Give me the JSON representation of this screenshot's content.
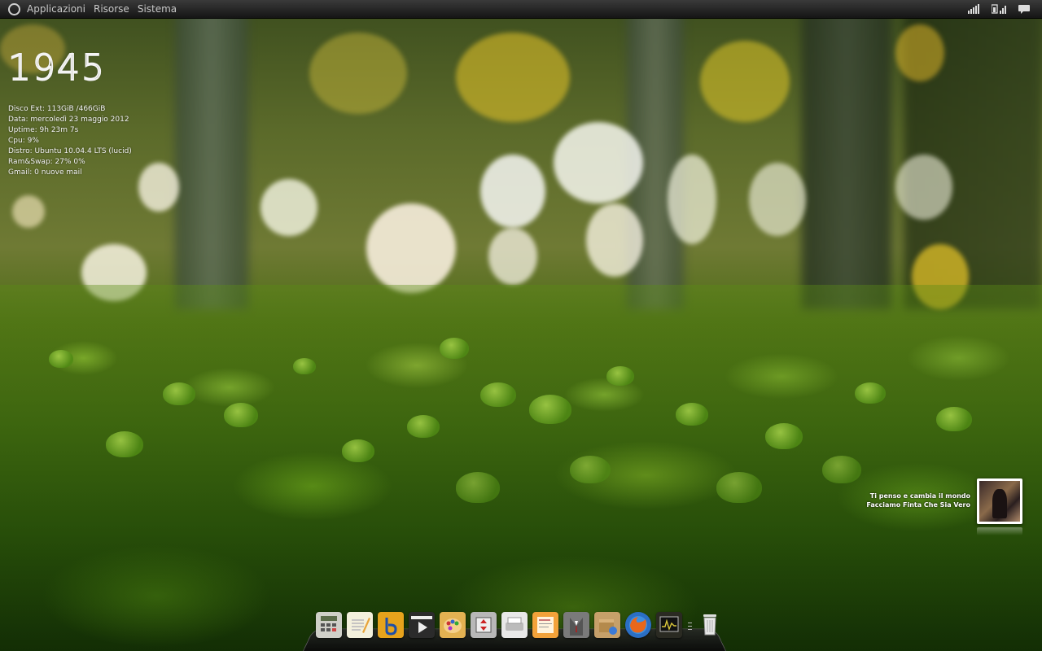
{
  "top_panel": {
    "menus": [
      "Applicazioni",
      "Risorse",
      "Sistema"
    ],
    "tray_icons": [
      "network-signal-icon",
      "battery-signal-icon",
      "message-icon"
    ]
  },
  "conky": {
    "clock": "1945",
    "lines": [
      "Disco Ext:  113GiB /466GiB",
      "Data: mercoledì  23 maggio 2012",
      "Uptime: 9h 23m 7s",
      "Cpu: 9%",
      "Distro: Ubuntu 10.04.4 LTS (lucid)",
      "Ram&Swap: 27% 0%",
      "Gmail: 0 nuove mail"
    ]
  },
  "now_playing": {
    "song": "Ti penso e cambia il mondo",
    "album": "Facciamo Finta Che Sia Vero",
    "cover_icon": "album-cover-icon"
  },
  "dock": {
    "items": [
      {
        "name": "calculator-icon",
        "color": "#cfcfc8"
      },
      {
        "name": "text-editor-icon",
        "color": "#f3f0dc"
      },
      {
        "name": "bluefish-icon",
        "color": "#e6a31c"
      },
      {
        "name": "video-player-icon",
        "color": "#2b2b2b"
      },
      {
        "name": "paint-icon",
        "color": "#e3b252"
      },
      {
        "name": "file-transfer-icon",
        "color": "#b8b8b8"
      },
      {
        "name": "scanner-icon",
        "color": "#e8e8e8"
      },
      {
        "name": "easytag-icon",
        "color": "#f2a23a"
      },
      {
        "name": "suit-icon",
        "color": "#7a7a7a"
      },
      {
        "name": "package-icon",
        "color": "#c6a06a"
      },
      {
        "name": "firefox-icon",
        "color": "#2b6fc4"
      },
      {
        "name": "system-monitor-icon",
        "color": "#2a2a22"
      },
      {
        "name": "trash-icon",
        "color": "#e0e0e0"
      }
    ]
  }
}
